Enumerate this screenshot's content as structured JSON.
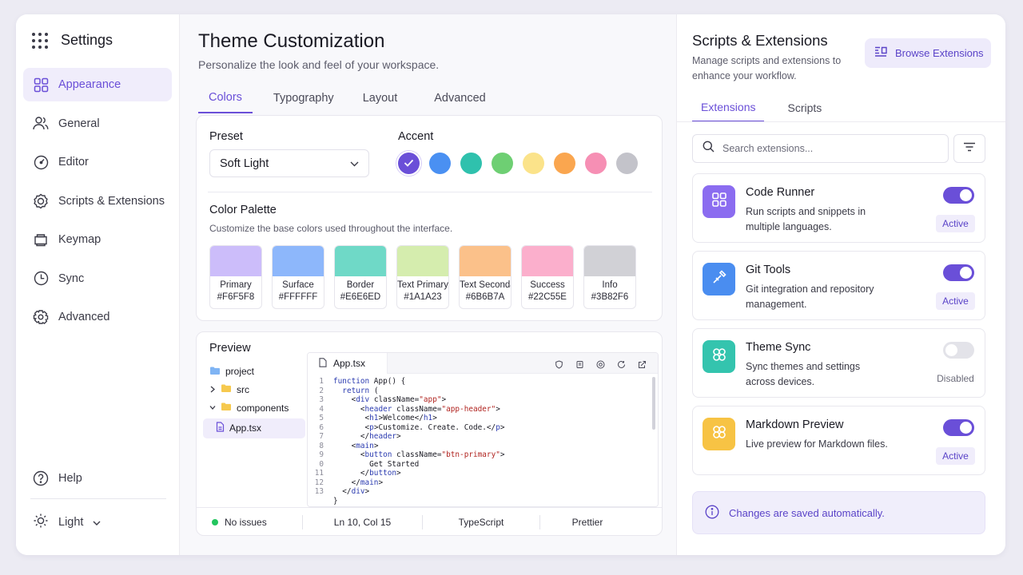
{
  "app": {
    "title": "Settings"
  },
  "sidebar": {
    "items": [
      {
        "label": "Appearance",
        "icon": "grid-icon"
      },
      {
        "label": "General",
        "icon": "users-icon"
      },
      {
        "label": "Editor",
        "icon": "gauge-icon"
      },
      {
        "label": "Scripts & Extensions",
        "icon": "badge-icon"
      },
      {
        "label": "Keymap",
        "icon": "cube-icon"
      },
      {
        "label": "Sync",
        "icon": "clock-icon"
      },
      {
        "label": "Advanced",
        "icon": "gear-icon"
      }
    ],
    "help_label": "Help",
    "theme_mode": "Light"
  },
  "main": {
    "title": "Theme Customization",
    "subtitle": "Personalize the look and feel of your workspace.",
    "tabs": [
      "Colors",
      "Typography",
      "Layout",
      "Advanced"
    ],
    "preset_label": "Preset",
    "preset_value": "Soft Light",
    "accent_label": "Accent",
    "accent_colors": [
      "#6A4FD8",
      "#4A90F2",
      "#2FC1AD",
      "#6ECF73",
      "#FBE38A",
      "#FAA64F",
      "#F68FB4",
      "#C3C3CA"
    ],
    "palette_title": "Color Palette",
    "palette_subtitle": "Customize the base colors used throughout the interface.",
    "palette": [
      {
        "name": "Primary",
        "hex": "#F6F5F8",
        "swatch": "#CCBDFA"
      },
      {
        "name": "Surface",
        "hex": "#FFFFFF",
        "swatch": "#8DB7FB"
      },
      {
        "name": "Border",
        "hex": "#E6E6ED",
        "swatch": "#6FD9C7"
      },
      {
        "name": "Text Primary",
        "hex": "#1A1A23",
        "swatch": "#D5EDAE"
      },
      {
        "name": "Text Secondary",
        "hex": "#6B6B7A",
        "swatch": "#FBC18A"
      },
      {
        "name": "Success",
        "hex": "#22C55E",
        "swatch": "#FBAFCC"
      },
      {
        "name": "Info",
        "hex": "#3B82F6",
        "swatch": "#D1D1D6"
      }
    ],
    "preview": {
      "title": "Preview",
      "tree": [
        "project",
        "src",
        "components",
        "App.tsx"
      ],
      "editor_tab": "App.tsx",
      "code": [
        [
          [
            "kw",
            "function"
          ],
          [
            "ct",
            " App() {"
          ]
        ],
        [
          [
            "ct",
            "  "
          ],
          [
            "kw",
            "return"
          ],
          [
            "ct",
            " ("
          ]
        ],
        [
          [
            "ct",
            "    <"
          ],
          [
            "tg",
            "div"
          ],
          [
            "ct",
            " className="
          ],
          [
            "st",
            "\"app\""
          ],
          [
            "ct",
            ">"
          ]
        ],
        [
          [
            "ct",
            "      <"
          ],
          [
            "tg",
            "header"
          ],
          [
            "ct",
            " className="
          ],
          [
            "st",
            "\"app-header\""
          ],
          [
            "ct",
            ">"
          ]
        ],
        [
          [
            "ct",
            "       <"
          ],
          [
            "tg",
            "h1"
          ],
          [
            "ct",
            ">Welcome</"
          ],
          [
            "tg",
            "h1"
          ],
          [
            "ct",
            ">"
          ]
        ],
        [
          [
            "ct",
            "       <"
          ],
          [
            "tg",
            "p"
          ],
          [
            "ct",
            ">Customize. Create. Code.</"
          ],
          [
            "tg",
            "p"
          ],
          [
            "ct",
            ">"
          ]
        ],
        [
          [
            "ct",
            "      </"
          ],
          [
            "tg",
            "header"
          ],
          [
            "ct",
            ">"
          ]
        ],
        [
          [
            "ct",
            "    <"
          ],
          [
            "tg",
            "main"
          ],
          [
            "ct",
            ">"
          ]
        ],
        [
          [
            "ct",
            "      <"
          ],
          [
            "tg",
            "button"
          ],
          [
            "ct",
            " className="
          ],
          [
            "st",
            "\"btn-primary\""
          ],
          [
            "ct",
            ">"
          ]
        ],
        [
          [
            "ct",
            "        Get Started"
          ]
        ],
        [
          [
            "ct",
            "      </"
          ],
          [
            "tg",
            "button"
          ],
          [
            "ct",
            ">"
          ]
        ],
        [
          [
            "ct",
            "    </"
          ],
          [
            "tg",
            "main"
          ],
          [
            "ct",
            ">"
          ]
        ],
        [
          [
            "ct",
            "  </"
          ],
          [
            "tg",
            "div"
          ],
          [
            "ct",
            ">"
          ]
        ],
        [
          [
            "ct",
            "}"
          ]
        ]
      ],
      "line_numbers": [
        "1",
        "2",
        "3",
        "4",
        "5",
        "6",
        "7",
        "8",
        "9",
        "0",
        "11",
        "12",
        "13"
      ],
      "status": {
        "issues": "No issues",
        "position": "Ln 10, Col 15",
        "language": "TypeScript",
        "formatter": "Prettier"
      }
    }
  },
  "right": {
    "title": "Scripts & Extensions",
    "subtitle": "Manage scripts and extensions to enhance your workflow.",
    "browse_label": "Browse Extensions",
    "tabs": [
      "Extensions",
      "Scripts"
    ],
    "search_placeholder": "Search extensions...",
    "extensions": [
      {
        "name": "Code Runner",
        "desc": "Run scripts and snippets in multiple languages.",
        "status": "Active",
        "enabled": true,
        "color": "#8B6CF0",
        "icon": "grid-icon"
      },
      {
        "name": "Git Tools",
        "desc": "Git integration and repository management.",
        "status": "Active",
        "enabled": true,
        "color": "#4A8DF0",
        "icon": "wand-icon"
      },
      {
        "name": "Theme Sync",
        "desc": "Sync themes and settings across devices.",
        "status": "Disabled",
        "enabled": false,
        "color": "#34C4AE",
        "icon": "flower-icon"
      },
      {
        "name": "Markdown Preview",
        "desc": "Live preview for Markdown files.",
        "status": "Active",
        "enabled": true,
        "color": "#F7C344",
        "icon": "flower-icon"
      }
    ],
    "info": "Changes are saved automatically."
  }
}
